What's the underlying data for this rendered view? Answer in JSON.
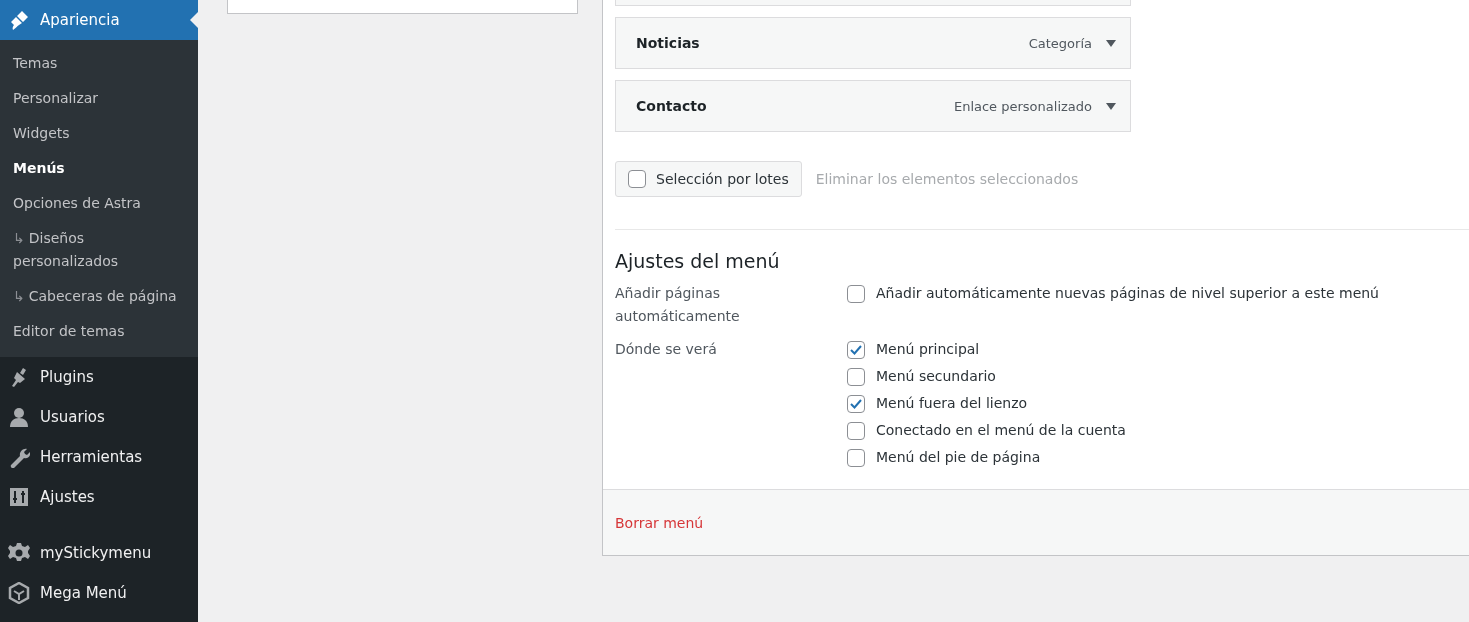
{
  "sidebar": {
    "items": [
      {
        "label": "Apariencia",
        "kind": "brush",
        "selected": true,
        "gap_before": false,
        "children": [
          {
            "label": "Temas",
            "selected": false
          },
          {
            "label": "Personalizar",
            "selected": false
          },
          {
            "label": "Widgets",
            "selected": false
          },
          {
            "label": "Menús",
            "selected": true
          },
          {
            "label": "Opciones de Astra",
            "selected": false
          },
          {
            "label": "Diseños personalizados",
            "prefix": "↳",
            "selected": false
          },
          {
            "label": "Cabeceras de página",
            "prefix": "↳",
            "selected": false
          },
          {
            "label": "Editor de temas",
            "selected": false
          }
        ]
      },
      {
        "label": "Plugins",
        "kind": "plug",
        "selected": false,
        "gap_before": false
      },
      {
        "label": "Usuarios",
        "kind": "user",
        "selected": false,
        "gap_before": false
      },
      {
        "label": "Herramientas",
        "kind": "wrench",
        "selected": false,
        "gap_before": false
      },
      {
        "label": "Ajustes",
        "kind": "sliders",
        "selected": false,
        "gap_before": false
      },
      {
        "label": "myStickymenu",
        "kind": "gear",
        "selected": false,
        "gap_before": true
      },
      {
        "label": "Mega Menú",
        "kind": "cube",
        "selected": false,
        "gap_before": false
      }
    ]
  },
  "menu_items": [
    {
      "title": "Noticias",
      "type": "Categoría"
    },
    {
      "title": "Contacto",
      "type": "Enlace personalizado"
    }
  ],
  "bulk_select": {
    "label": "Selección por lotes",
    "checked": false
  },
  "remove_selected_link": "Eliminar los elementos seleccionados",
  "menu_settings": {
    "heading": "Ajustes del menú",
    "rows": [
      {
        "label": "Añadir páginas automáticamente",
        "options": [
          {
            "label": "Añadir automáticamente nuevas páginas de nivel superior a este menú",
            "checked": false
          }
        ]
      },
      {
        "label": "Dónde se verá",
        "options": [
          {
            "label": "Menú principal",
            "checked": true
          },
          {
            "label": "Menú secundario",
            "checked": false
          },
          {
            "label": "Menú fuera del lienzo",
            "checked": true
          },
          {
            "label": "Conectado en el menú de la cuenta",
            "checked": false
          },
          {
            "label": "Menú del pie de página",
            "checked": false
          }
        ]
      }
    ]
  },
  "delete_menu_link": "Borrar menú"
}
